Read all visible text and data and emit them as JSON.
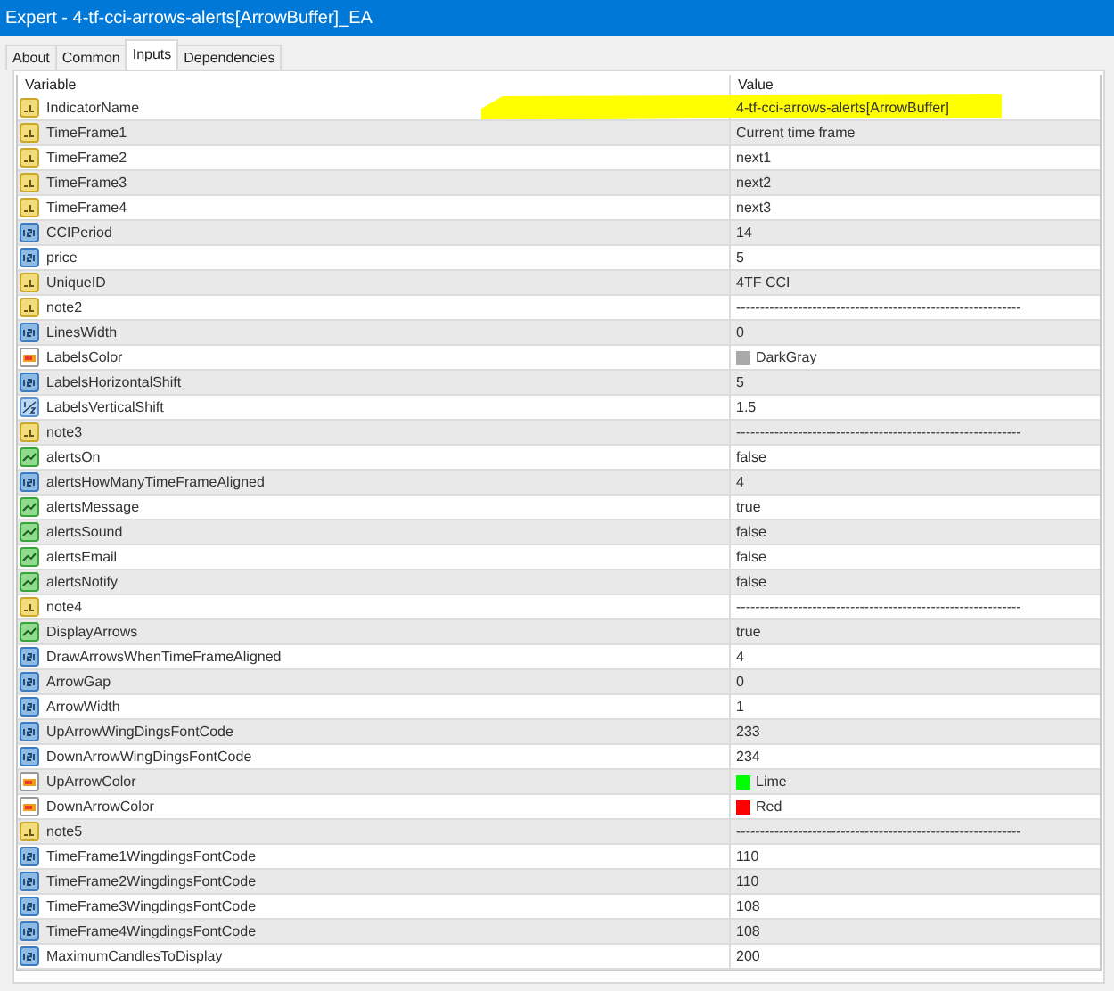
{
  "window": {
    "title": "Expert - 4-tf-cci-arrows-alerts[ArrowBuffer]_EA"
  },
  "tabs": [
    {
      "label": "About",
      "selected": false
    },
    {
      "label": "Common",
      "selected": false
    },
    {
      "label": "Inputs",
      "selected": true
    },
    {
      "label": "Dependencies",
      "selected": false
    }
  ],
  "table": {
    "columns": [
      "Variable",
      "Value"
    ],
    "rows": [
      {
        "kind": "string",
        "variable": "IndicatorName",
        "value": "4-tf-cci-arrows-alerts[ArrowBuffer]",
        "highlighted": true
      },
      {
        "kind": "string",
        "variable": "TimeFrame1",
        "value": "Current time frame"
      },
      {
        "kind": "string",
        "variable": "TimeFrame2",
        "value": "next1"
      },
      {
        "kind": "string",
        "variable": "TimeFrame3",
        "value": "next2"
      },
      {
        "kind": "string",
        "variable": "TimeFrame4",
        "value": "next3"
      },
      {
        "kind": "int",
        "variable": "CCIPeriod",
        "value": "14"
      },
      {
        "kind": "int",
        "variable": "price",
        "value": "5"
      },
      {
        "kind": "string",
        "variable": "UniqueID",
        "value": "4TF CCI"
      },
      {
        "kind": "string",
        "variable": "note2",
        "value": "------------------------------------------------------------"
      },
      {
        "kind": "int",
        "variable": "LinesWidth",
        "value": "0"
      },
      {
        "kind": "color",
        "variable": "LabelsColor",
        "value": "DarkGray",
        "color": "#a9a9a9"
      },
      {
        "kind": "int",
        "variable": "LabelsHorizontalShift",
        "value": "5"
      },
      {
        "kind": "double",
        "variable": "LabelsVerticalShift",
        "value": "1.5"
      },
      {
        "kind": "string",
        "variable": "note3",
        "value": "------------------------------------------------------------"
      },
      {
        "kind": "bool",
        "variable": "alertsOn",
        "value": "false"
      },
      {
        "kind": "int",
        "variable": "alertsHowManyTimeFrameAligned",
        "value": "4"
      },
      {
        "kind": "bool",
        "variable": "alertsMessage",
        "value": "true"
      },
      {
        "kind": "bool",
        "variable": "alertsSound",
        "value": "false"
      },
      {
        "kind": "bool",
        "variable": "alertsEmail",
        "value": "false"
      },
      {
        "kind": "bool",
        "variable": "alertsNotify",
        "value": "false"
      },
      {
        "kind": "string",
        "variable": "note4",
        "value": "------------------------------------------------------------"
      },
      {
        "kind": "bool",
        "variable": "DisplayArrows",
        "value": "true"
      },
      {
        "kind": "int",
        "variable": "DrawArrowsWhenTimeFrameAligned",
        "value": "4"
      },
      {
        "kind": "int",
        "variable": "ArrowGap",
        "value": "0"
      },
      {
        "kind": "int",
        "variable": "ArrowWidth",
        "value": "1"
      },
      {
        "kind": "int",
        "variable": "UpArrowWingDingsFontCode",
        "value": "233"
      },
      {
        "kind": "int",
        "variable": "DownArrowWingDingsFontCode",
        "value": "234"
      },
      {
        "kind": "color",
        "variable": "UpArrowColor",
        "value": "Lime",
        "color": "#00ff00"
      },
      {
        "kind": "color",
        "variable": "DownArrowColor",
        "value": "Red",
        "color": "#ff0000"
      },
      {
        "kind": "string",
        "variable": "note5",
        "value": "------------------------------------------------------------"
      },
      {
        "kind": "int",
        "variable": "TimeFrame1WingdingsFontCode",
        "value": "110"
      },
      {
        "kind": "int",
        "variable": "TimeFrame2WingdingsFontCode",
        "value": "110"
      },
      {
        "kind": "int",
        "variable": "TimeFrame3WingdingsFontCode",
        "value": "108"
      },
      {
        "kind": "int",
        "variable": "TimeFrame4WingdingsFontCode",
        "value": "108"
      },
      {
        "kind": "int",
        "variable": "MaximumCandlesToDisplay",
        "value": "200"
      }
    ]
  }
}
